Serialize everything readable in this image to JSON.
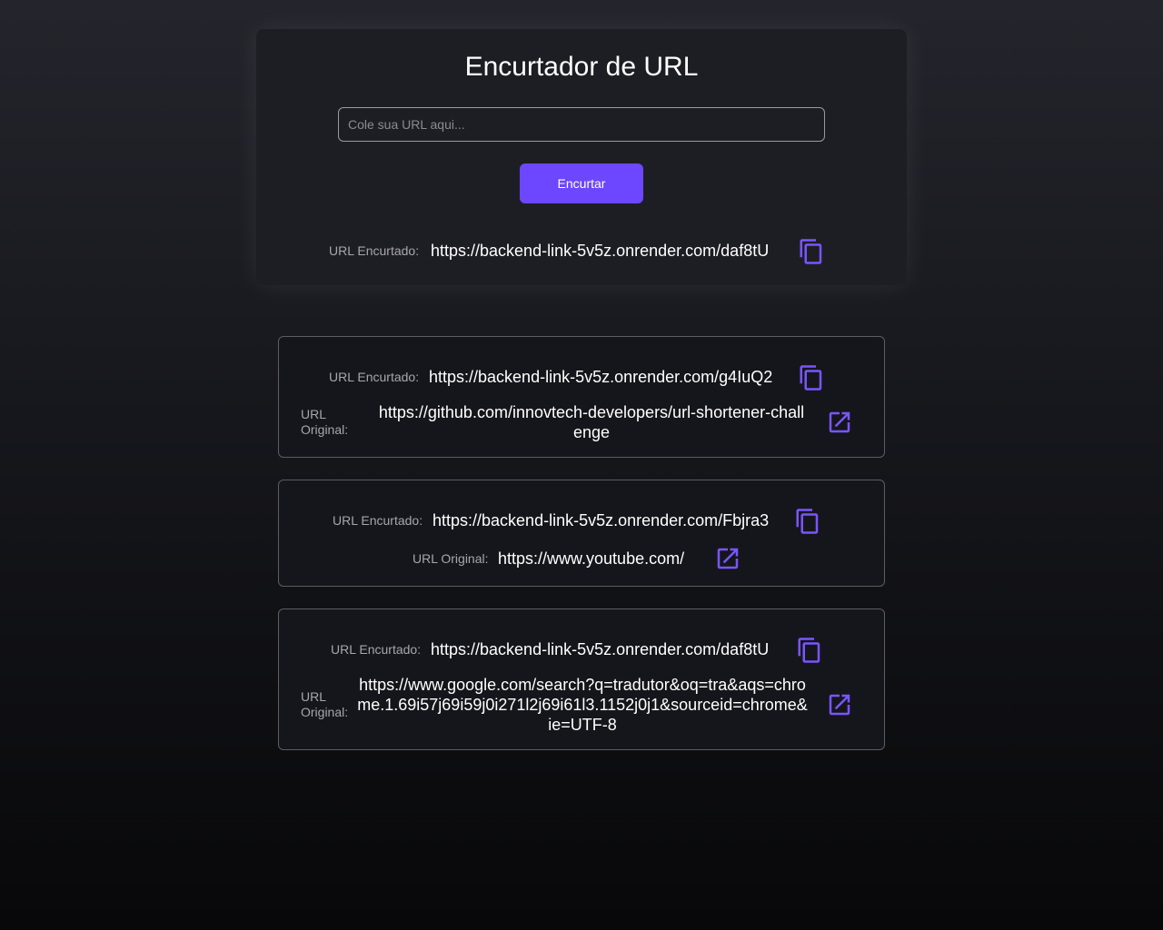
{
  "main": {
    "title": "Encurtador de URL",
    "input_placeholder": "Cole sua URL aqui...",
    "input_value": "",
    "button_label": "Encurtar",
    "result_label": "URL Encurtado:",
    "result_url": "https://backend-link-5v5z.onrender.com/daf8tU"
  },
  "cards": [
    {
      "short_label": "URL Encurtado:",
      "short_url": "https://backend-link-5v5z.onrender.com/g4IuQ2",
      "original_label": "URL Original:",
      "original_url": "https://github.com/innovtech-developers/url-shortener-challenge"
    },
    {
      "short_label": "URL Encurtado:",
      "short_url": "https://backend-link-5v5z.onrender.com/Fbjra3",
      "original_label": "URL Original:",
      "original_url": "https://www.youtube.com/"
    },
    {
      "short_label": "URL Encurtado:",
      "short_url": "https://backend-link-5v5z.onrender.com/daf8tU",
      "original_label": "URL Original:",
      "original_url": "https://www.google.com/search?q=tradutor&oq=tra&aqs=chrome.1.69i57j69i59j0i271l2j69i61l3.1152j0j1&sourceid=chrome&ie=UTF-8"
    }
  ],
  "icons": {
    "copy": "copy-icon",
    "open": "open-in-new-icon"
  },
  "colors": {
    "accent": "#6c47ff",
    "icon": "#7a55ff",
    "background_top": "#24252c",
    "background_bottom": "#08080a",
    "card_border": "#5c5c62"
  }
}
